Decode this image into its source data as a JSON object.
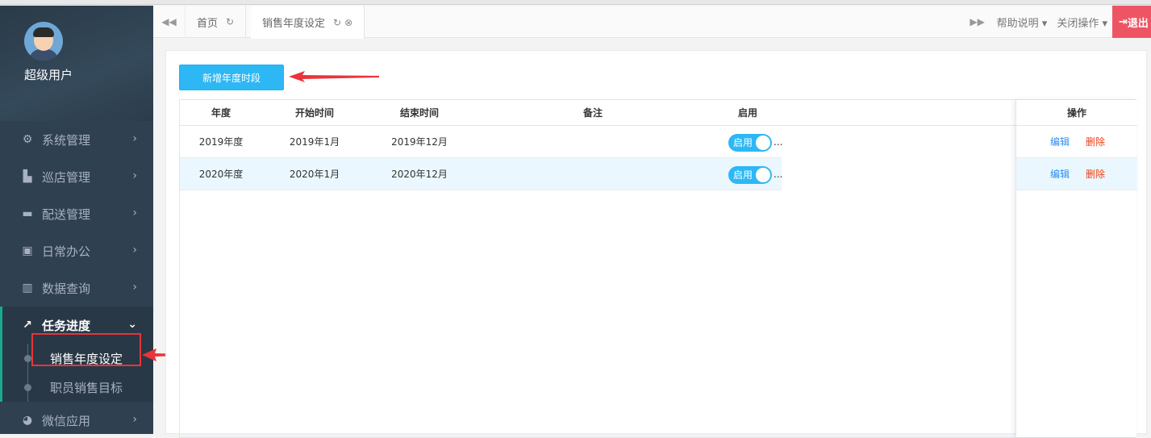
{
  "sidebar": {
    "username": "超级用户",
    "items": [
      {
        "label": "系统管理",
        "icon": "gears-icon"
      },
      {
        "label": "巡店管理",
        "icon": "sitemap-icon"
      },
      {
        "label": "配送管理",
        "icon": "truck-icon"
      },
      {
        "label": "日常办公",
        "icon": "briefcase-icon"
      },
      {
        "label": "数据查询",
        "icon": "bar-chart-icon"
      },
      {
        "label": "任务进度",
        "icon": "line-chart-icon"
      },
      {
        "label": "微信应用",
        "icon": "wechat-icon"
      }
    ],
    "submenu": [
      {
        "label": "销售年度设定"
      },
      {
        "label": "职员销售目标"
      }
    ]
  },
  "tabs": [
    {
      "label": "首页"
    },
    {
      "label": "销售年度设定"
    }
  ],
  "toolbar": {
    "help": "帮助说明",
    "close_ops": "关闭操作",
    "logout": "退出"
  },
  "main": {
    "add_button": "新增年度时段",
    "columns": [
      "年度",
      "开始时间",
      "结束时间",
      "备注",
      "启用",
      "操作"
    ],
    "rows": [
      {
        "year": "2019年度",
        "start": "2019年1月",
        "end": "2019年12月",
        "note": "",
        "enabled": "启用",
        "edit": "编辑",
        "delete": "删除"
      },
      {
        "year": "2020年度",
        "start": "2020年1月",
        "end": "2020年12月",
        "note": "",
        "enabled": "启用",
        "edit": "编辑",
        "delete": "删除"
      }
    ],
    "ellipsis": "..."
  },
  "colors": {
    "sidebar_bg": "#2f4050",
    "accent": "#2db7f5",
    "delete": "#ed3f14",
    "edit": "#2d8cf0",
    "logout": "#ed5565",
    "annotation": "#e8343a"
  }
}
